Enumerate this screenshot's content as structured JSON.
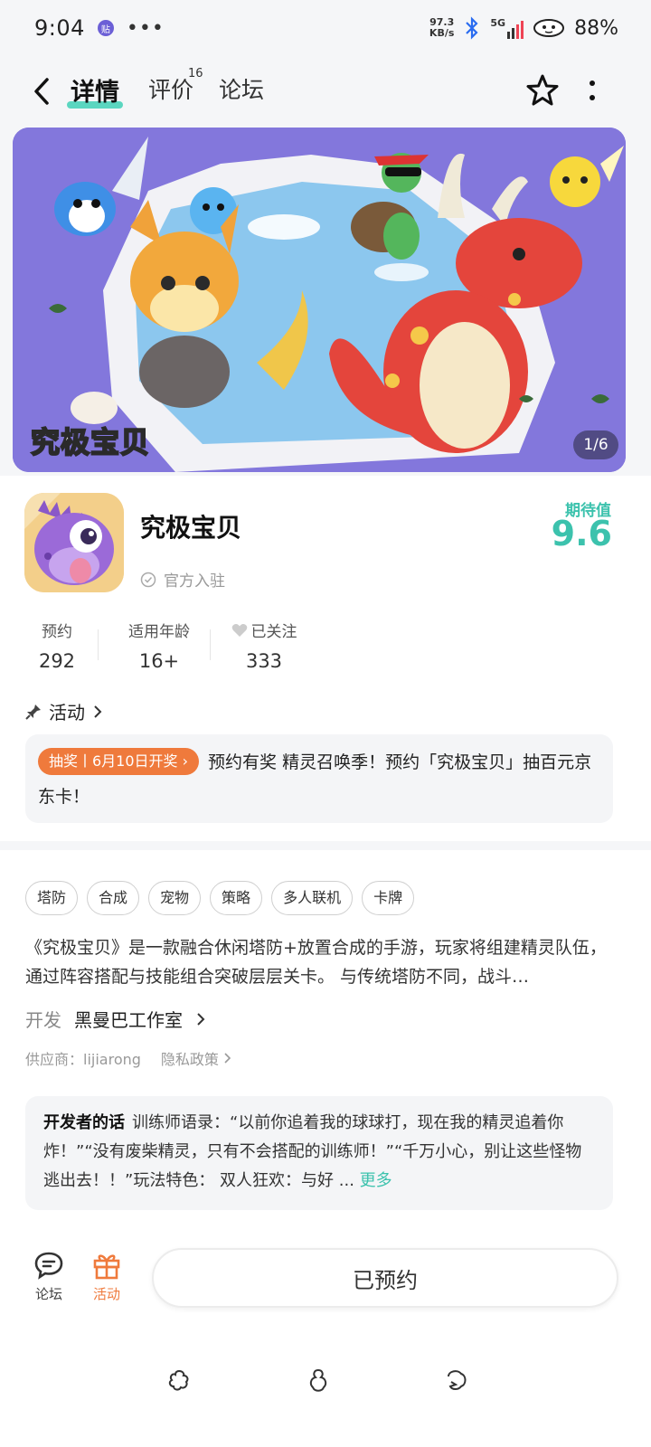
{
  "status_bar": {
    "time": "9:04",
    "app_badge": "贴",
    "dots": "•••",
    "speed_top": "97.3",
    "speed_bottom": "KB/s",
    "network": "5G",
    "battery": "88%"
  },
  "nav": {
    "tabs": [
      {
        "label": "详情",
        "active": true
      },
      {
        "label": "评价",
        "badge": "16"
      },
      {
        "label": "论坛"
      }
    ]
  },
  "banner": {
    "logo_text": "究极宝贝",
    "page_current": 1,
    "page_total": 6,
    "counter": "1/6"
  },
  "game": {
    "name": "究极宝贝",
    "official": "官方入驻",
    "expect_label": "期待值",
    "expect_score": "9.6"
  },
  "stats": [
    {
      "label": "预约",
      "value": "292"
    },
    {
      "label": "适用年龄",
      "value": "16+"
    },
    {
      "label": "已关注",
      "value": "333"
    }
  ],
  "activity": {
    "heading": "活动",
    "badge": "抽奖丨6月10日开奖",
    "text": "预约有奖 精灵召唤季！预约「究极宝贝」抽百元京东卡！"
  },
  "tags": [
    "塔防",
    "合成",
    "宠物",
    "策略",
    "多人联机",
    "卡牌"
  ],
  "description": "《究极宝贝》是一款融合休闲塔防+放置合成的手游，玩家将组建精灵队伍，通过阵容搭配与技能组合突破层层关卡。 与传统塔防不同，战斗…",
  "developer": {
    "label": "开发",
    "name": "黑曼巴工作室",
    "supplier": "供应商：lijiarong",
    "privacy": "隐私政策"
  },
  "dev_words": {
    "title": "开发者的话",
    "text": "训练师语录：“以前你追着我的球球打，现在我的精灵追着你炸！”“没有废柴精灵，只有不会搭配的训练师！”“千万小心，别让这些怪物逃出去！！”玩法特色： 双人狂欢：与好 ...",
    "more": "更多"
  },
  "action_bar": {
    "forum": "论坛",
    "activity": "活动",
    "reserve_button": "已预约"
  },
  "colors": {
    "accent": "#3cc2ad",
    "orange": "#ef7a3c",
    "banner_bg": "#7d70d9"
  }
}
